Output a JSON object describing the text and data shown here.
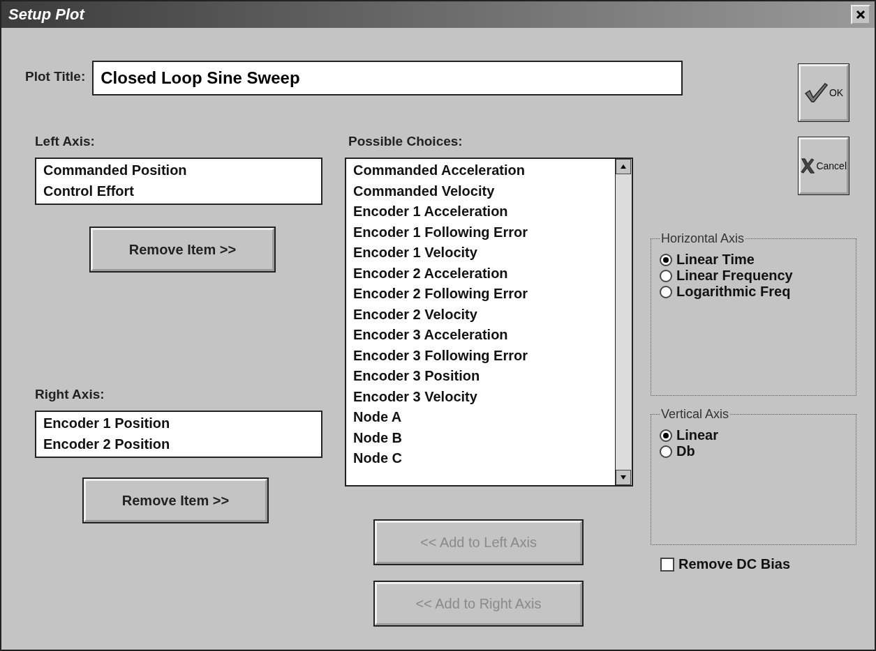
{
  "window": {
    "title": "Setup Plot"
  },
  "plot_title": {
    "label": "Plot Title:",
    "value": "Closed Loop Sine Sweep"
  },
  "dialog_buttons": [
    {
      "kind": "ok",
      "label": "OK",
      "disabled": false
    },
    {
      "kind": "cancel",
      "label": "Cancel",
      "disabled": false
    }
  ],
  "left_axis": {
    "label": "Left Axis:",
    "items": [
      "Commanded Position",
      "Control Effort"
    ],
    "button": {
      "label": "Remove Item >>",
      "disabled": false
    }
  },
  "right_axis": {
    "label": "Right Axis:",
    "items": [
      "Encoder 1 Position",
      "Encoder 2 Position"
    ],
    "button": {
      "label": "Remove Item >>",
      "disabled": false
    }
  },
  "possible_choices": {
    "label": "Possible Choices:",
    "items": [
      "Commanded Acceleration",
      "Commanded Velocity",
      "Encoder 1 Acceleration",
      "Encoder 1 Following Error",
      "Encoder 1 Velocity",
      "Encoder 2 Acceleration",
      "Encoder 2 Following Error",
      "Encoder 2 Velocity",
      "Encoder 3 Acceleration",
      "Encoder 3 Following Error",
      "Encoder 3 Position",
      "Encoder 3 Velocity",
      "Node A",
      "Node B",
      "Node C"
    ]
  },
  "add_buttons": [
    {
      "label": "<< Add to Left Axis",
      "disabled": true
    },
    {
      "label": "<< Add to Right Axis",
      "disabled": true
    }
  ],
  "horizontal_axis": {
    "title": "Horizontal Axis",
    "options": [
      {
        "label": "Linear Time",
        "selected": true
      },
      {
        "label": "Linear Frequency",
        "selected": false
      },
      {
        "label": "Logarithmic Freq",
        "selected": false
      }
    ]
  },
  "vertical_axis": {
    "title": "Vertical Axis",
    "options": [
      {
        "label": "Linear",
        "selected": true
      },
      {
        "label": "Db",
        "selected": false
      }
    ]
  },
  "remove_dc_bias": {
    "label": "Remove DC Bias",
    "checked": false
  }
}
